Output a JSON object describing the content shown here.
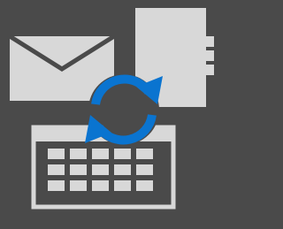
{
  "colors": {
    "background": "#4a4a4a",
    "icon_light": "#d8d8d8",
    "icon_dark_stroke": "#4a4a4a",
    "sync_accent": "#0a74d0",
    "calendar_cells": "#d8d8d8"
  },
  "icons": [
    "mail-envelope-icon",
    "contacts-address-book-icon",
    "calendar-icon",
    "sync-arrows-icon"
  ]
}
